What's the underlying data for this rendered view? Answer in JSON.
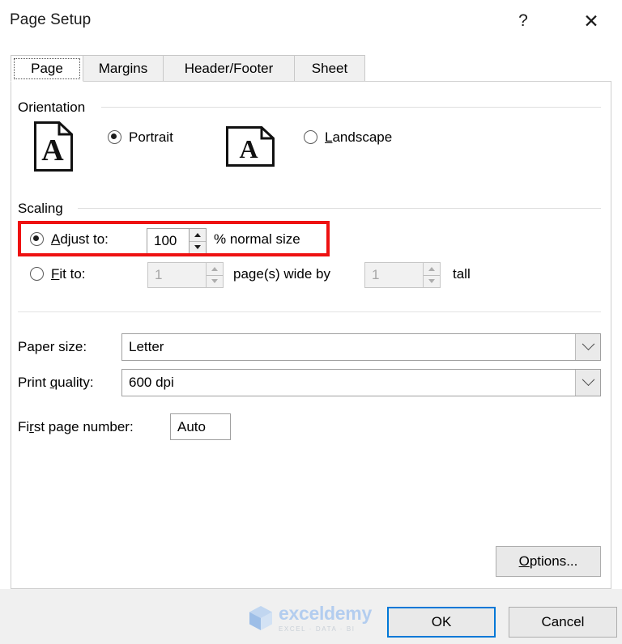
{
  "window": {
    "title": "Page Setup",
    "help_icon": "question-mark-icon",
    "close_icon": "close-icon"
  },
  "tabs": [
    {
      "label": "Page",
      "active": true
    },
    {
      "label": "Margins",
      "active": false
    },
    {
      "label": "Header/Footer",
      "active": false
    },
    {
      "label": "Sheet",
      "active": false
    }
  ],
  "orientation": {
    "group_label": "Orientation",
    "portrait": {
      "label": "Portrait",
      "selected": true,
      "icon": "portrait-page-icon"
    },
    "landscape": {
      "label": "Landscape",
      "selected": false,
      "icon": "landscape-page-icon"
    }
  },
  "scaling": {
    "group_label": "Scaling",
    "adjust_to": {
      "label": "Adjust to:",
      "selected": true,
      "value": "100",
      "suffix": "% normal size",
      "highlighted": true
    },
    "fit_to": {
      "label": "Fit to:",
      "selected": false,
      "wide_value": "1",
      "middle_text": "page(s) wide by",
      "tall_value": "1",
      "tall_text": "tall",
      "disabled": true
    }
  },
  "paper": {
    "paper_size_label": "Paper size:",
    "paper_size_value": "Letter",
    "print_quality_label": "Print quality:",
    "print_quality_value": "600 dpi",
    "first_page_label": "First page number:",
    "first_page_value": "Auto"
  },
  "buttons": {
    "options": "Options...",
    "ok": "OK",
    "cancel": "Cancel"
  },
  "watermark": {
    "name": "exceldemy",
    "tagline": "EXCEL · DATA · BI"
  },
  "colors": {
    "highlight_red": "#ee1111",
    "focus_blue": "#0078d7",
    "dialog_bg": "#ffffff",
    "footer_bg": "#f0f0f0"
  }
}
